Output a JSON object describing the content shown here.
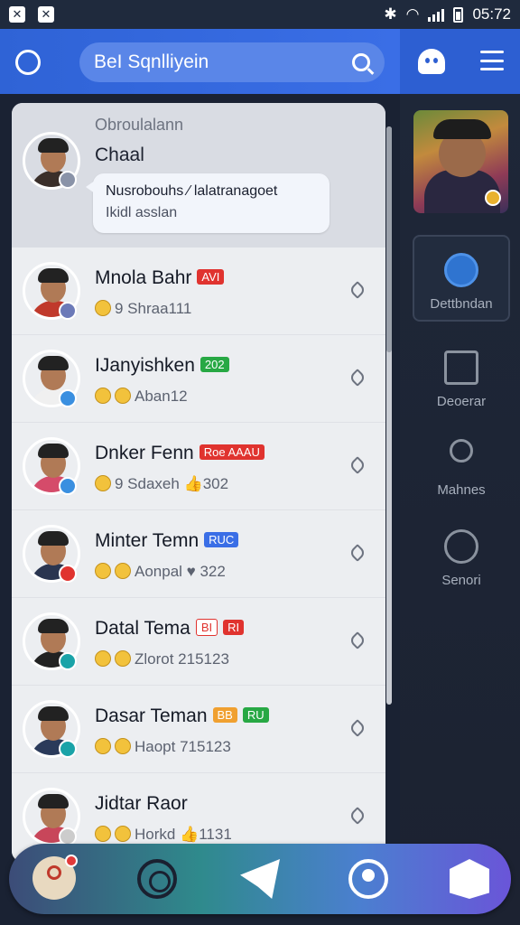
{
  "status_bar": {
    "time": "05:72"
  },
  "app_bar": {
    "search_text": "BeI Sqnlliyein"
  },
  "pinned": {
    "header": "Obroulalann",
    "name": "Chaal",
    "message_line1": "Nusrobouhs ∕ lalatranagoet",
    "message_line2": "Ikidl asslan"
  },
  "chats": [
    {
      "name": "Mnola Bahr",
      "tags": [
        {
          "text": "AVI",
          "color": "#e0332f"
        }
      ],
      "sub": "9 Shraa111",
      "sub_emojis": 1,
      "avatar_torso": "#c0392b",
      "badge_color": "#6c7ab8"
    },
    {
      "name": "IJanyishken",
      "tags": [
        {
          "text": "202",
          "color": "#27a844"
        }
      ],
      "sub": "Aban12",
      "sub_emojis": 2,
      "avatar_torso": "#f0f0f0",
      "badge_color": "#3a8fe0"
    },
    {
      "name": "Dnker Fenn",
      "tags": [
        {
          "text": "Roe AAAU",
          "color": "#e0332f"
        }
      ],
      "sub": "9 Sdaxeh 👍302",
      "sub_emojis": 1,
      "avatar_torso": "#d54b6a",
      "badge_color": "#3a8fe0"
    },
    {
      "name": "Minter Temn",
      "tags": [
        {
          "text": "RUC",
          "color": "#3a6ee6"
        }
      ],
      "sub": "Aonpal ♥ 322",
      "sub_emojis": 2,
      "avatar_torso": "#2a3550",
      "badge_color": "#e0332f"
    },
    {
      "name": "Datal Tema",
      "tags": [
        {
          "text": "BI",
          "color": "#ffffff"
        },
        {
          "text": "RI",
          "color": "#e0332f"
        }
      ],
      "sub": "Zlorot 215123",
      "sub_emojis": 2,
      "avatar_torso": "#222",
      "badge_color": "#1aa3a8"
    },
    {
      "name": "Dasar Teman",
      "tags": [
        {
          "text": "BB",
          "color": "#f0a030"
        },
        {
          "text": "RU",
          "color": "#27a844"
        }
      ],
      "sub": "Haopt 715123",
      "sub_emojis": 2,
      "avatar_torso": "#2a3a5a",
      "badge_color": "#1aa3a8"
    },
    {
      "name": "Jidtar Raor",
      "tags": [],
      "sub": "Horkd 👍1131",
      "sub_emojis": 2,
      "avatar_torso": "#c8465a",
      "badge_color": "#cccccc"
    }
  ],
  "side_panel": {
    "items": [
      {
        "label": "Dettbndan"
      },
      {
        "label": "Deoerar"
      },
      {
        "label": "Mahnes"
      },
      {
        "label": "Senori"
      }
    ]
  }
}
